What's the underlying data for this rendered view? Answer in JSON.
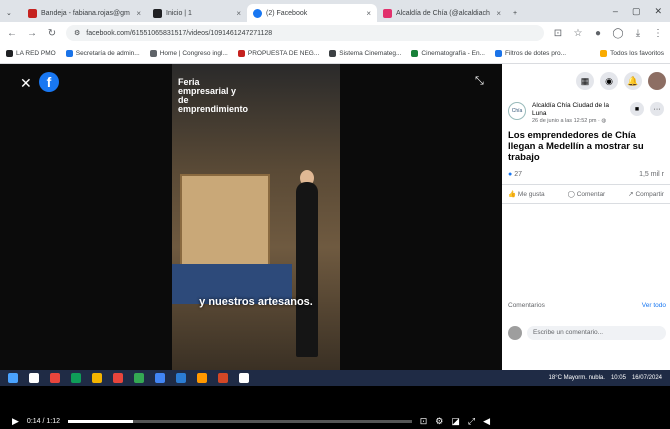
{
  "browser": {
    "tabs": [
      {
        "label": "Bandeja - fabiana.rojas@gm",
        "color": "#c5221f"
      },
      {
        "label": "Inicio | 1",
        "color": "#202124"
      },
      {
        "label": "(2) Facebook",
        "color": "#1877f2",
        "active": true
      },
      {
        "label": "Alcaldía de Chía (@alcaldiach",
        "color": "#e1306c"
      }
    ],
    "url": "facebook.com/61551065831517/videos/1091461247271128",
    "bookmarks": [
      "LA RED PMO",
      "Secretaría de admin...",
      "Home | Congreso ingl...",
      "PROPUESTA DE NEG...",
      "Sistema Cinemateg...",
      "Cinematografía - En...",
      "Filtros de dotes pro...",
      "Todos los favoritos"
    ]
  },
  "video": {
    "overlay_title": "Feria empresarial y de emprendimiento",
    "caption": "y nuestros artesanos.",
    "time": "0:14 / 1:12",
    "progress": 0.19
  },
  "post": {
    "page_name": "Alcaldía Chía Ciudad de la Luna",
    "meta": "26 de junio a las 12:52 pm · ",
    "title": "Los emprendedores de Chía llegan a Medellín a mostrar su trabajo",
    "reactions": "27",
    "views": "1,5 mil r",
    "like": "Me gusta",
    "comment": "Comentar",
    "share": "Compartir",
    "comments_label": "Comentarios",
    "see_all": "Ver todo",
    "write_placeholder": "Escribe un comentario..."
  },
  "taskbar": {
    "weather": "18°C Mayorm. nubla.",
    "time": "10:05",
    "date": "16/07/2024"
  }
}
